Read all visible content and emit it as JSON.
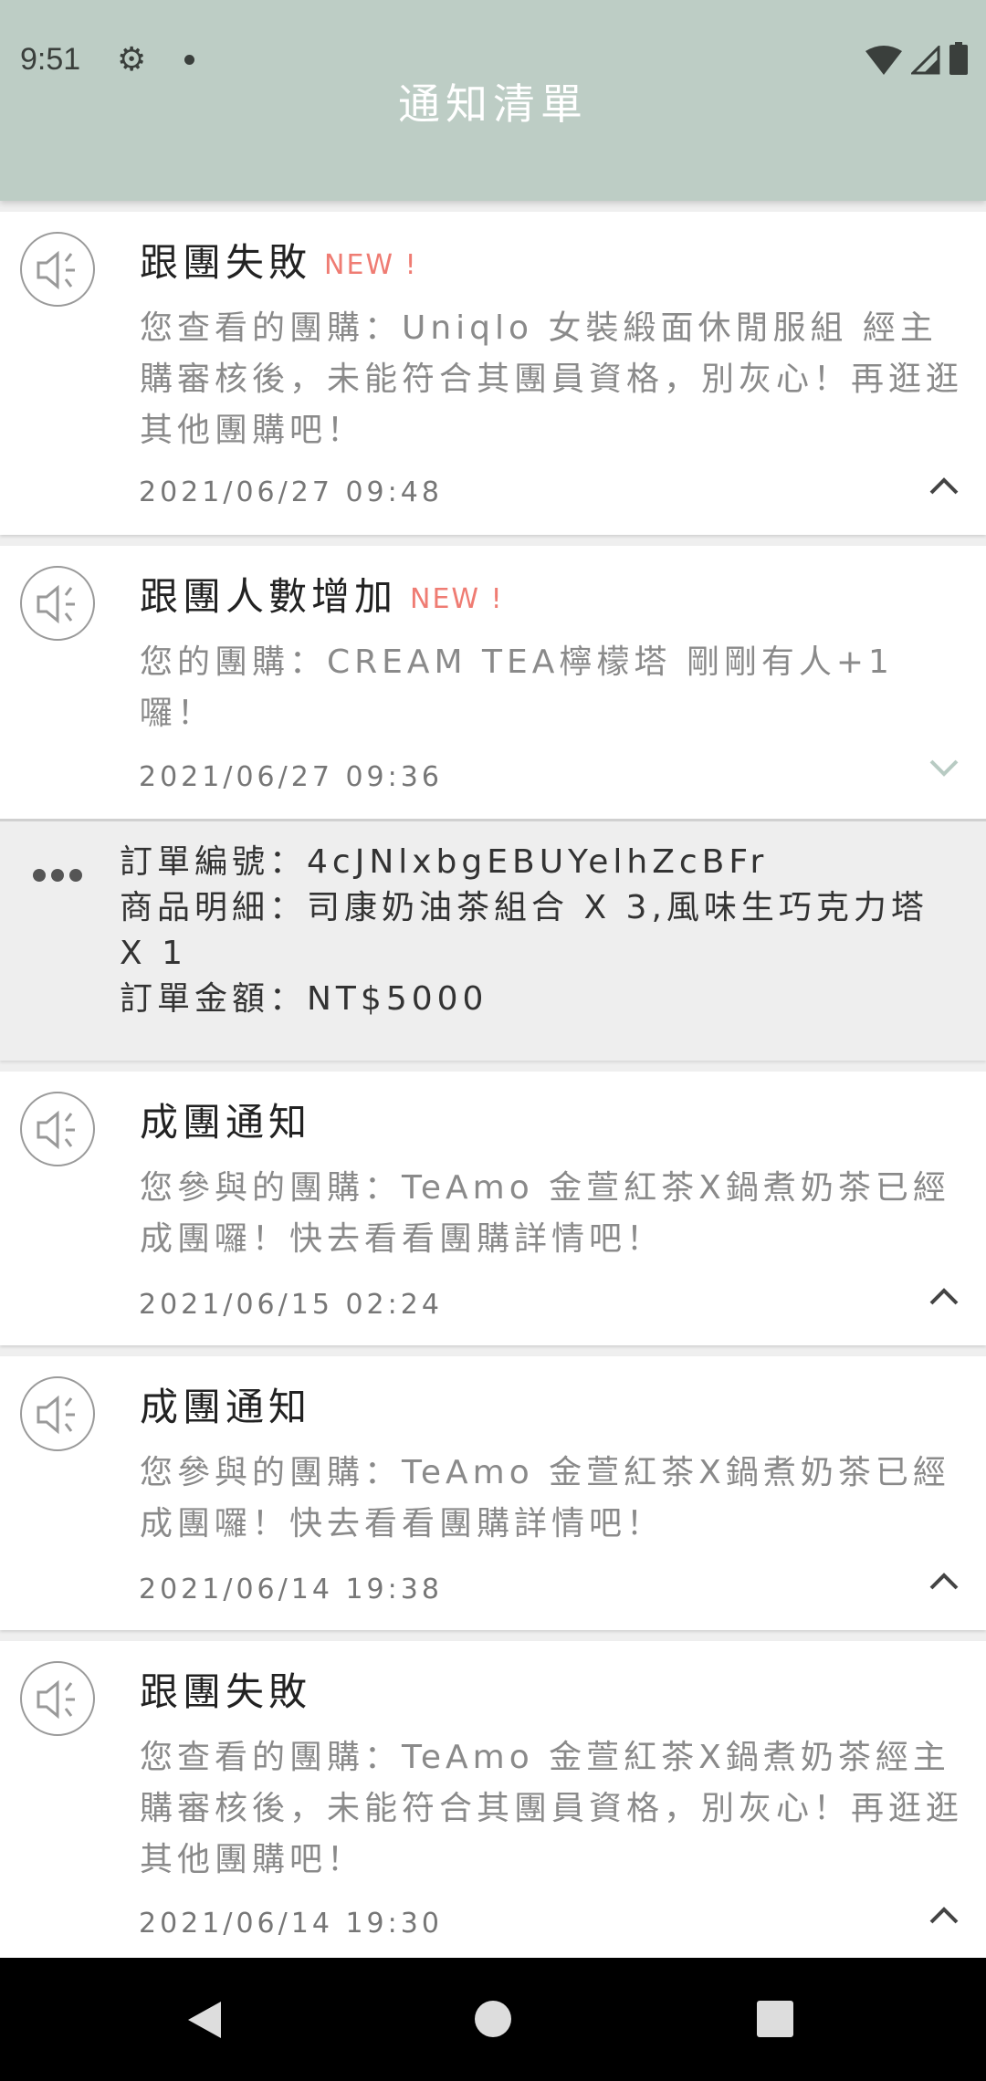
{
  "status_bar": {
    "time": "9:51"
  },
  "header": {
    "title": "通知清單"
  },
  "notifications": [
    {
      "title": "跟團失敗",
      "badge": "NEW !",
      "body": "您查看的團購：Uniqlo 女裝緞面休閒服組 經主購審核後，未能符合其團員資格，別灰心！再逛逛其他團購吧！",
      "date": "2021/06/27 09:48",
      "expanded": false
    },
    {
      "title": "跟團人數增加",
      "badge": "NEW !",
      "body": "您的團購：CREAM TEA檸檬塔 剛剛有人+1囉！",
      "date": "2021/06/27 09:36",
      "expanded": true,
      "detail": {
        "order_no": "訂單編號：4cJNlxbgEBUYelhZcBFr",
        "items": "商品明細：司康奶油茶組合 X 3,風味生巧克力塔 X 1",
        "amount": "訂單金額：NT$5000"
      }
    },
    {
      "title": "成團通知",
      "body": "您參與的團購：TeAmo 金萱紅茶X鍋煮奶茶已經成團囉！快去看看團購詳情吧！",
      "date": "2021/06/15 02:24",
      "expanded": false
    },
    {
      "title": "成團通知",
      "body": "您參與的團購：TeAmo 金萱紅茶X鍋煮奶茶已經成團囉！快去看看團購詳情吧！",
      "date": "2021/06/14 19:38",
      "expanded": false
    },
    {
      "title": "跟團失敗",
      "body": "您查看的團購：TeAmo 金萱紅茶X鍋煮奶茶經主購審核後，未能符合其團員資格，別灰心！再逛逛其他團購吧！",
      "date": "2021/06/14 19:30",
      "expanded": false
    }
  ],
  "colors": {
    "header": "#bdcdc5",
    "new_badge": "#ef7c73",
    "chevron_active": "#b8cbc3"
  }
}
